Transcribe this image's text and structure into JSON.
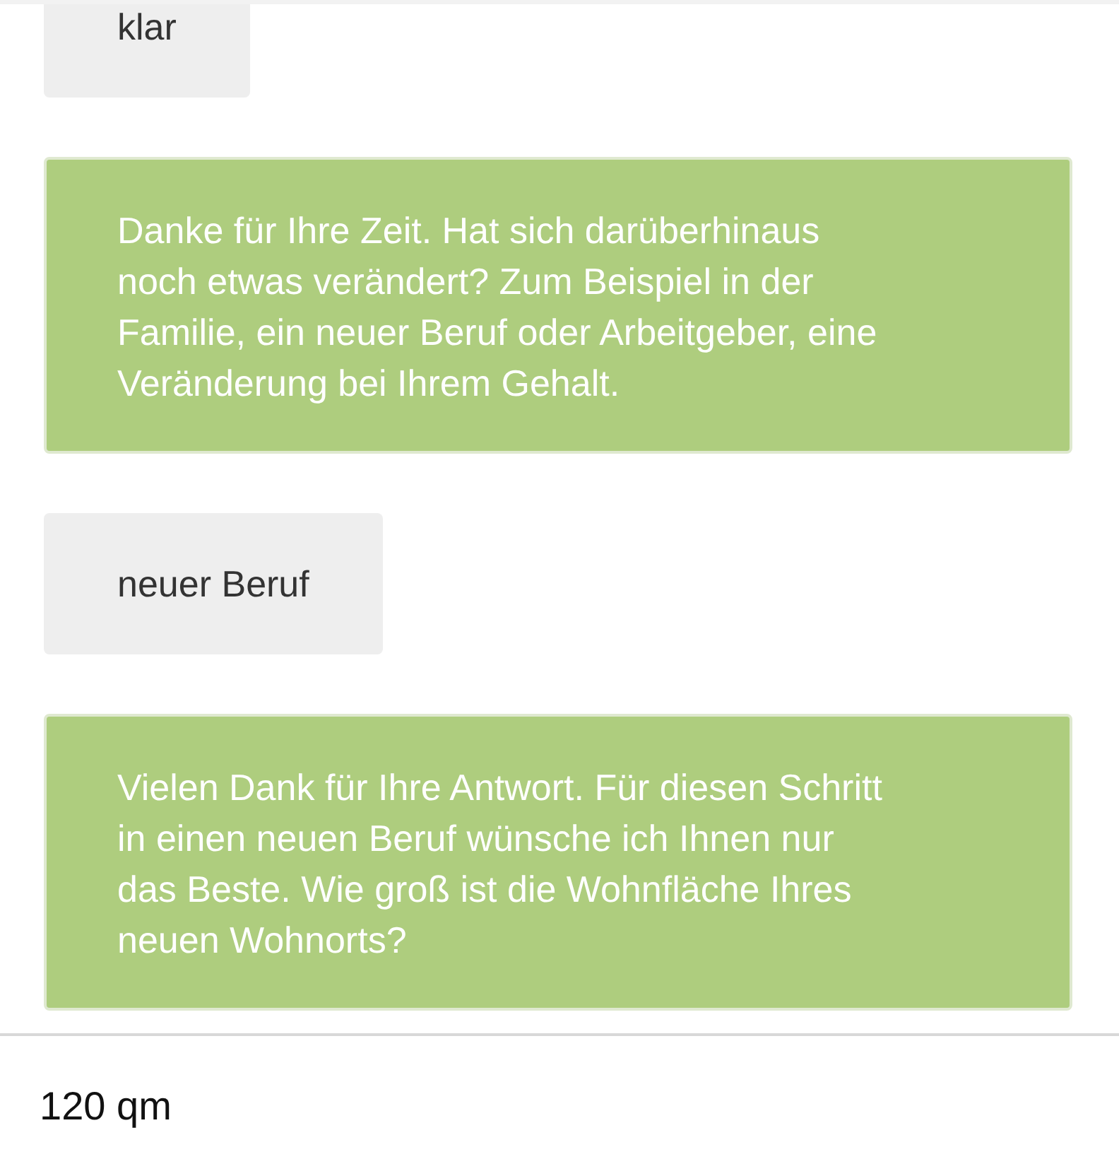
{
  "messages": [
    {
      "kind": "user",
      "text": "klar"
    },
    {
      "kind": "bot",
      "text": "Danke für Ihre Zeit. Hat sich darüberhinaus noch etwas verändert? Zum Beispiel in der Familie, ein neuer Beruf oder Arbeitgeber, eine Veränderung bei Ihrem Gehalt."
    },
    {
      "kind": "user",
      "text": "neuer Beruf"
    },
    {
      "kind": "bot",
      "text": "Vielen Dank für Ihre Antwort. Für diesen Schritt in einen neuen Beruf wünsche ich Ihnen nur das Beste. Wie groß ist die Wohnfläche Ihres neuen Wohnorts?"
    }
  ],
  "input": {
    "value": "120 qm"
  }
}
